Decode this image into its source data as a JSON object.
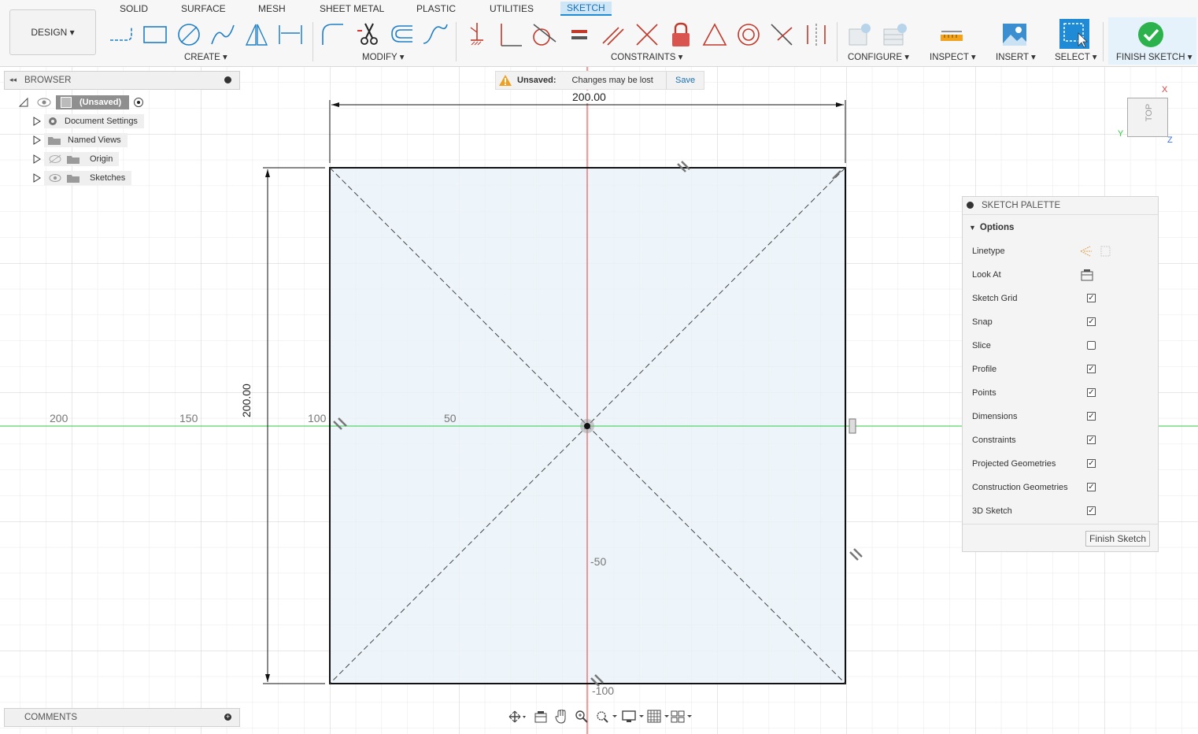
{
  "design_menu": {
    "label": "DESIGN ▾"
  },
  "tabs": [
    {
      "label": "SOLID"
    },
    {
      "label": "SURFACE"
    },
    {
      "label": "MESH"
    },
    {
      "label": "SHEET METAL"
    },
    {
      "label": "PLASTIC"
    },
    {
      "label": "UTILITIES"
    },
    {
      "label": "SKETCH"
    }
  ],
  "groups": {
    "create": "CREATE ▾",
    "modify": "MODIFY ▾",
    "constraints": "CONSTRAINTS ▾",
    "configure": "CONFIGURE ▾",
    "inspect": "INSPECT ▾",
    "insert": "INSERT ▾",
    "select": "SELECT ▾",
    "finish": "FINISH SKETCH ▾"
  },
  "browser": {
    "title": "BROWSER",
    "root": "(Unsaved)",
    "items": [
      "Document Settings",
      "Named Views",
      "Origin",
      "Sketches"
    ]
  },
  "unsaved": {
    "label": "Unsaved:",
    "message": "Changes may be lost",
    "save": "Save"
  },
  "sketch": {
    "dim_horizontal": "200.00",
    "dim_vertical": "200.00",
    "axis_labels_x": [
      "200",
      "150",
      "100",
      "50"
    ],
    "axis_labels_y": [
      "-50",
      "-100"
    ]
  },
  "viewcube": {
    "face": "TOP",
    "x": "X",
    "y": "Y",
    "z": "Z"
  },
  "palette": {
    "title": "SKETCH PALETTE",
    "section": "Options",
    "rows": [
      {
        "label": "Linetype",
        "type": "icons"
      },
      {
        "label": "Look At",
        "type": "icon"
      },
      {
        "label": "Sketch Grid",
        "checked": true
      },
      {
        "label": "Snap",
        "checked": true
      },
      {
        "label": "Slice",
        "checked": false
      },
      {
        "label": "Profile",
        "checked": true
      },
      {
        "label": "Points",
        "checked": true
      },
      {
        "label": "Dimensions",
        "checked": true
      },
      {
        "label": "Constraints",
        "checked": true
      },
      {
        "label": "Projected Geometries",
        "checked": true
      },
      {
        "label": "Construction Geometries",
        "checked": true
      },
      {
        "label": "3D Sketch",
        "checked": true
      }
    ],
    "finish_button": "Finish Sketch"
  },
  "comments": {
    "title": "COMMENTS"
  },
  "colors": {
    "accent": "#1f8ad6",
    "x_axis": "#e03b3b",
    "y_axis": "#2ecc40",
    "profile_fill": "#eaf3fa",
    "finish_green": "#2bb24c"
  }
}
